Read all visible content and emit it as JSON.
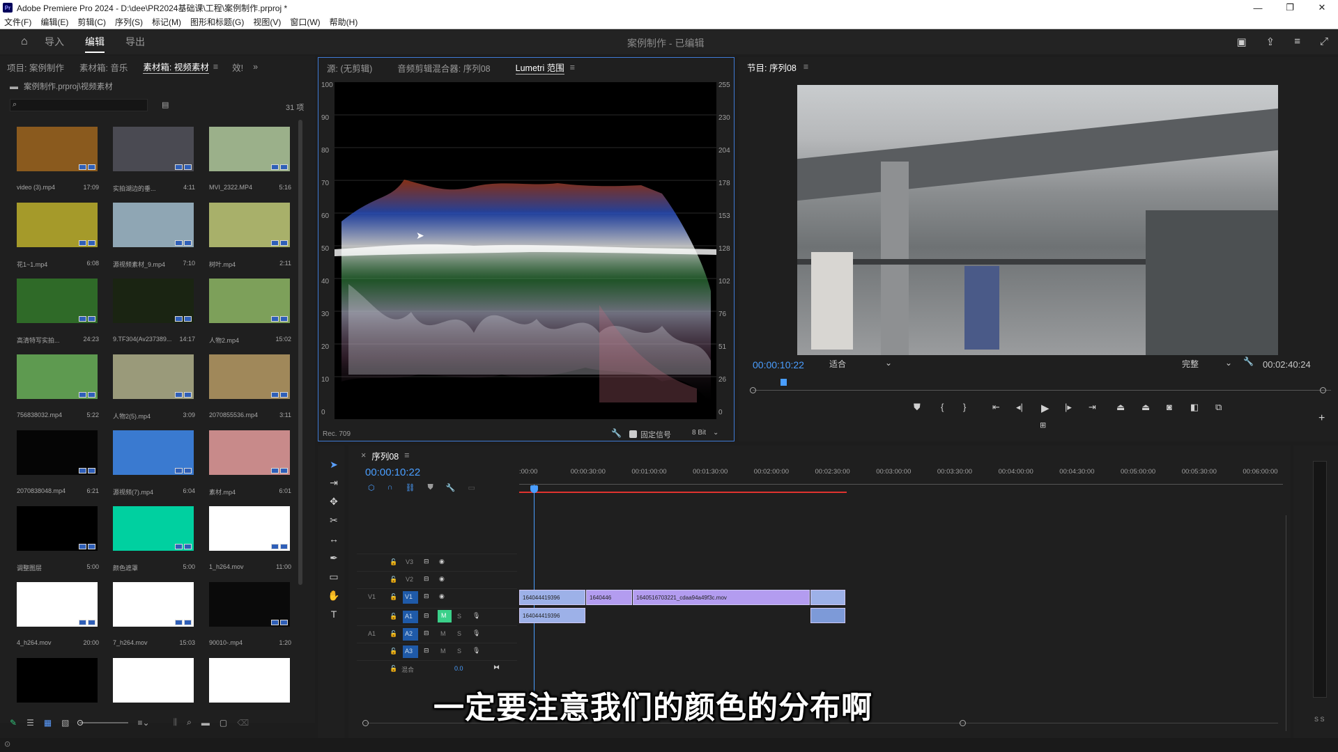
{
  "window": {
    "title": "Adobe Premiere Pro 2024 - D:\\dee\\PR2024基础课\\工程\\案例制作.prproj *",
    "logo": "Pr",
    "controls": [
      "—",
      "❐",
      "✕"
    ]
  },
  "menu": [
    "文件(F)",
    "编辑(E)",
    "剪辑(C)",
    "序列(S)",
    "标记(M)",
    "图形和标题(G)",
    "视图(V)",
    "窗口(W)",
    "帮助(H)"
  ],
  "workspace": {
    "tabs": [
      "导入",
      "编辑",
      "导出"
    ],
    "active": "编辑",
    "doc_title": "案例制作 - 已编辑"
  },
  "project_panel": {
    "tabs": [
      "项目: 案例制作",
      "素材箱: 音乐",
      "素材箱: 视频素材",
      "效!"
    ],
    "path": "案例制作.prproj\\视频素材",
    "item_count": "31 项",
    "items": [
      {
        "name": "video (3).mp4",
        "dur": "17:09",
        "color": "#8a5a1e"
      },
      {
        "name": "实拍湖边的垂...",
        "dur": "4:11",
        "color": "#4a4a52"
      },
      {
        "name": "MVI_2322.MP4",
        "dur": "5:16",
        "color": "#9bb08a"
      },
      {
        "name": "花1~1.mp4",
        "dur": "6:08",
        "color": "#a59a2a"
      },
      {
        "name": "源视频素材_9.mp4",
        "dur": "7:10",
        "color": "#8fa6b4"
      },
      {
        "name": "树叶.mp4",
        "dur": "2:11",
        "color": "#a8b06a"
      },
      {
        "name": "高清特写实拍...",
        "dur": "24:23",
        "color": "#2f6a28"
      },
      {
        "name": "9.TF304(Av237389...",
        "dur": "14:17",
        "color": "#1a2412"
      },
      {
        "name": "人物2.mp4",
        "dur": "15:02",
        "color": "#7da05a"
      },
      {
        "name": "756838032.mp4",
        "dur": "5:22",
        "color": "#5e9a50"
      },
      {
        "name": "人物2(5).mp4",
        "dur": "3:09",
        "color": "#9a9a7a"
      },
      {
        "name": "2070855536.mp4",
        "dur": "3:11",
        "color": "#a0885a"
      },
      {
        "name": "2070838048.mp4",
        "dur": "6:21",
        "color": "#050505"
      },
      {
        "name": "源视频(7).mp4",
        "dur": "6:04",
        "color": "#3a7ad0"
      },
      {
        "name": "素材.mp4",
        "dur": "6:01",
        "color": "#c88a8a"
      },
      {
        "name": "调整图层",
        "dur": "5:00",
        "color": "#000000"
      },
      {
        "name": "颜色遮罩",
        "dur": "5:00",
        "color": "#00d0a0"
      },
      {
        "name": "1_h264.mov",
        "dur": "11:00",
        "color": "#ffffff"
      },
      {
        "name": "4_h264.mov",
        "dur": "20:00",
        "color": "#ffffff"
      },
      {
        "name": "7_h264.mov",
        "dur": "15:03",
        "color": "#ffffff"
      },
      {
        "name": "90010-.mp4",
        "dur": "1:20",
        "color": "#0a0a0a"
      },
      {
        "name": "",
        "dur": "",
        "color": "#000000"
      },
      {
        "name": "",
        "dur": "",
        "color": "#ffffff"
      },
      {
        "name": "",
        "dur": "",
        "color": "#ffffff"
      }
    ]
  },
  "source_panel": {
    "tabs": [
      "源: (无剪辑)",
      "音频剪辑混合器: 序列08",
      "Lumetri 范围"
    ],
    "active": "Lumetri 范围",
    "left_axis": [
      "100",
      "90",
      "80",
      "70",
      "60",
      "50",
      "40",
      "30",
      "20",
      "10",
      "0"
    ],
    "right_axis": [
      "255",
      "230",
      "204",
      "178",
      "153",
      "128",
      "102",
      "76",
      "51",
      "26",
      "0"
    ],
    "colorspace": "Rec. 709",
    "clamp_label": "固定信号",
    "bitdepth": "8 Bit"
  },
  "program_panel": {
    "title": "节目: 序列08",
    "timecode": "00:00:10:22",
    "fit": "适合",
    "quality": "完整",
    "duration": "00:02:40:24"
  },
  "timeline": {
    "tab": "序列08",
    "timecode": "00:00:10:22",
    "ruler": [
      ":00:00",
      "00:00:30:00",
      "00:01:00:00",
      "00:01:30:00",
      "00:02:00:00",
      "00:02:30:00",
      "00:03:00:00",
      "00:03:30:00",
      "00:04:00:00",
      "00:04:30:00",
      "00:05:00:00",
      "00:05:30:00",
      "00:06:00:00"
    ],
    "tracks": {
      "video": [
        "V3",
        "V2",
        "V1"
      ],
      "audio": [
        "A1",
        "A2",
        "A3"
      ],
      "src_v": "V1",
      "src_a": "A1",
      "mix_label": "混合",
      "mix_value": "0.0",
      "m": "M",
      "s": "S"
    },
    "clips": {
      "v1_a": "164044419396",
      "v1_b": "1640446",
      "v1_c": "1640516703221_cdaa94a49f3c.mov",
      "a1_a": "164044419396"
    }
  },
  "subtitle": "一定要注意我们的颜色的分布啊",
  "meter": "S S"
}
